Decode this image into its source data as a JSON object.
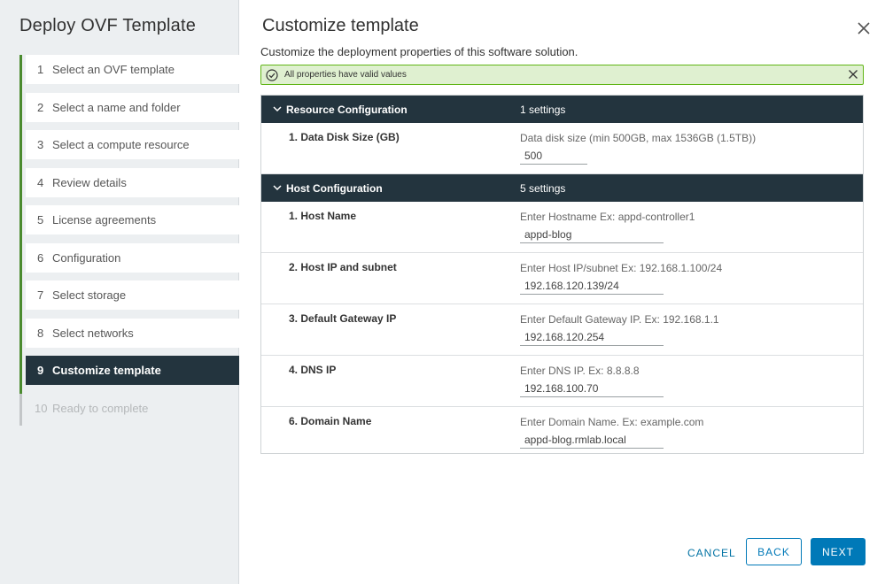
{
  "dialog": {
    "title": "Deploy OVF Template"
  },
  "steps": [
    {
      "num": "1",
      "label": "Select an OVF template"
    },
    {
      "num": "2",
      "label": "Select a name and folder"
    },
    {
      "num": "3",
      "label": "Select a compute resource"
    },
    {
      "num": "4",
      "label": "Review details"
    },
    {
      "num": "5",
      "label": "License agreements"
    },
    {
      "num": "6",
      "label": "Configuration"
    },
    {
      "num": "7",
      "label": "Select storage"
    },
    {
      "num": "8",
      "label": "Select networks"
    },
    {
      "num": "9",
      "label": "Customize template"
    },
    {
      "num": "10",
      "label": "Ready to complete"
    }
  ],
  "page": {
    "title": "Customize template",
    "subtitle": "Customize the deployment properties of this software solution."
  },
  "alert": {
    "text": "All properties have valid values"
  },
  "groups": [
    {
      "name": "Resource Configuration",
      "count": "1 settings",
      "rows": [
        {
          "label": "1. Data Disk Size (GB)",
          "hint": "Data disk size (min 500GB, max 1536GB (1.5TB))",
          "value": "500"
        }
      ]
    },
    {
      "name": "Host Configuration",
      "count": "5 settings",
      "rows": [
        {
          "label": "1. Host Name",
          "hint": "Enter Hostname Ex: appd-controller1",
          "value": "appd-blog"
        },
        {
          "label": "2. Host IP and subnet",
          "hint": "Enter Host IP/subnet Ex: 192.168.1.100/24",
          "value": "192.168.120.139/24"
        },
        {
          "label": "3. Default Gateway IP",
          "hint": "Enter Default Gateway IP. Ex: 192.168.1.1",
          "value": "192.168.120.254"
        },
        {
          "label": "4. DNS IP",
          "hint": "Enter DNS IP. Ex: 8.8.8.8",
          "value": "192.168.100.70"
        },
        {
          "label": "6. Domain Name",
          "hint": "Enter Domain Name. Ex: example.com",
          "value": "appd-blog.rmlab.local"
        }
      ]
    }
  ],
  "buttons": {
    "cancel": "CANCEL",
    "back": "BACK",
    "next": "NEXT"
  },
  "colors": {
    "accent": "#0079b8",
    "header_dark": "#23343e",
    "step_done": "#4b8b2f",
    "alert_bg": "#dff0d0",
    "alert_border": "#60b515"
  }
}
